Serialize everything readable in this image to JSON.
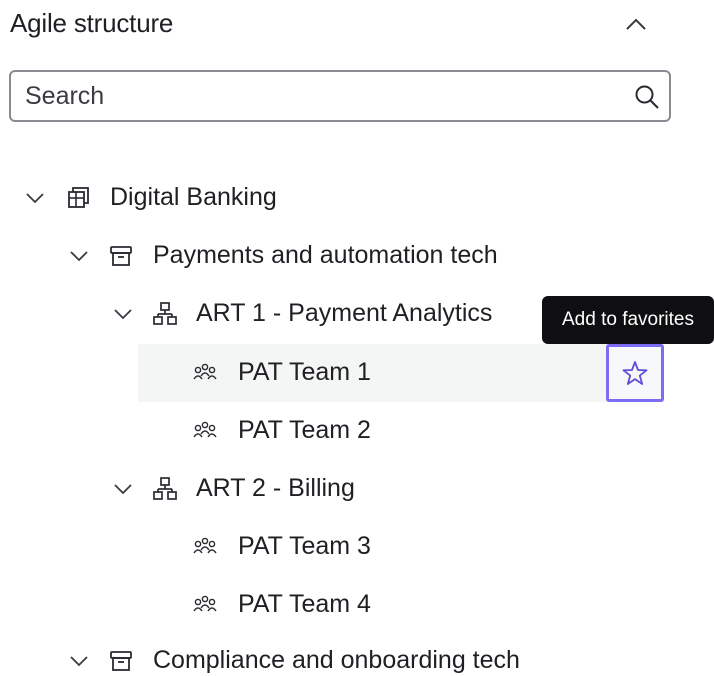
{
  "panel": {
    "title": "Agile structure"
  },
  "search": {
    "placeholder": "Search",
    "value": ""
  },
  "tree": {
    "portfolio": {
      "label": "Digital Banking",
      "icon": "portfolio-icon"
    },
    "solution_1": {
      "label": "Payments and automation tech",
      "icon": "archive-box-icon"
    },
    "art_1": {
      "label": "ART 1 - Payment Analytics",
      "icon": "hierarchy-icon"
    },
    "team_1": {
      "label": "PAT Team 1",
      "icon": "team-icon"
    },
    "team_2": {
      "label": "PAT Team 2",
      "icon": "team-icon"
    },
    "art_2": {
      "label": "ART 2 - Billing",
      "icon": "hierarchy-icon"
    },
    "team_3": {
      "label": "PAT Team 3",
      "icon": "team-icon"
    },
    "team_4": {
      "label": "PAT Team 4",
      "icon": "team-icon"
    },
    "solution_2": {
      "label": "Compliance and onboarding tech",
      "icon": "archive-box-icon"
    }
  },
  "tooltip": {
    "text": "Add to favorites"
  },
  "colors": {
    "focus_ring": "#7b6cf2",
    "star": "#5b4fd6",
    "tooltip_bg": "#0f0f12",
    "row_highlight": "#f3f6f4"
  }
}
